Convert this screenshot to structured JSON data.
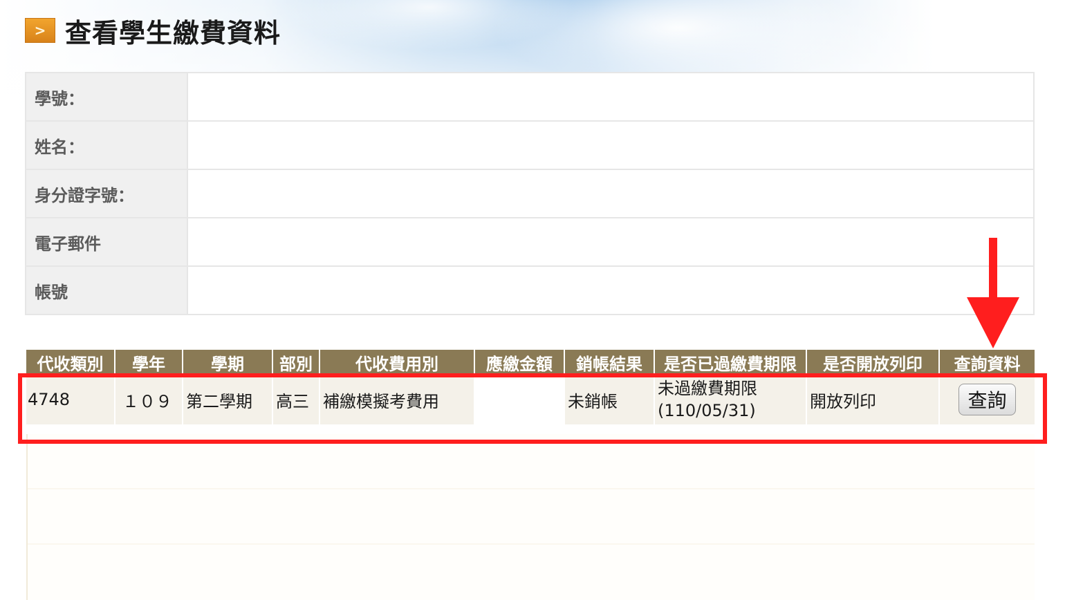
{
  "page": {
    "title": "查看學生繳費資料"
  },
  "student_info": {
    "rows": [
      {
        "label": "學號：",
        "value": ""
      },
      {
        "label": "姓名：",
        "value": ""
      },
      {
        "label": "身分證字號：",
        "value": ""
      },
      {
        "label": "電子郵件",
        "value": ""
      },
      {
        "label": "帳號",
        "value": ""
      }
    ]
  },
  "fee_table": {
    "headers": [
      "代收類別",
      "學年",
      "學期",
      "部別",
      "代收費用別",
      "應繳金額",
      "銷帳結果",
      "是否已過繳費期限",
      "是否開放列印",
      "查詢資料"
    ],
    "rows": [
      {
        "category": "4748",
        "year": "１０９",
        "semester": "第二學期",
        "division": "高三",
        "fee_type": "補繳模擬考費用",
        "amount": "",
        "result": "未銷帳",
        "deadline_status": "未過繳費期限",
        "deadline_date": "(110/05/31)",
        "print_status": "開放列印",
        "query_label": "查詢"
      }
    ]
  },
  "annotations": {
    "highlight_color": "#ff1e1e"
  }
}
